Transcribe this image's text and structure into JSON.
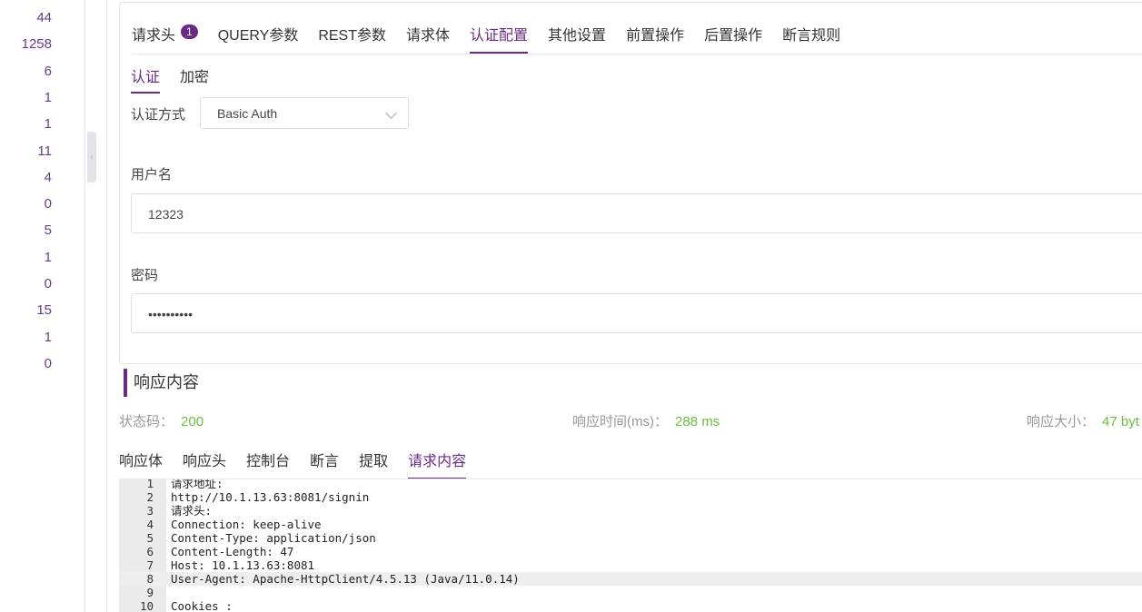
{
  "left_numbers": [
    "44",
    "1258",
    "6",
    "1",
    "1",
    "11",
    "4",
    "0",
    "5",
    "1",
    "0",
    "15",
    "1",
    "0"
  ],
  "config": {
    "tabs": [
      {
        "label": "请求头",
        "badge": "1",
        "active": false
      },
      {
        "label": "QUERY参数",
        "active": false
      },
      {
        "label": "REST参数",
        "active": false
      },
      {
        "label": "请求体",
        "active": false
      },
      {
        "label": "认证配置",
        "active": true
      },
      {
        "label": "其他设置",
        "active": false
      },
      {
        "label": "前置操作",
        "active": false
      },
      {
        "label": "后置操作",
        "active": false
      },
      {
        "label": "断言规则",
        "active": false
      }
    ],
    "subtabs": [
      {
        "label": "认证",
        "active": true
      },
      {
        "label": "加密",
        "active": false
      }
    ],
    "auth_method_label": "认证方式",
    "auth_method_value": "Basic Auth",
    "username_label": "用户名",
    "username_value": "12323",
    "password_label": "密码",
    "password_value": "••••••••••"
  },
  "response": {
    "title": "响应内容",
    "status_label": "状态码：",
    "status_value": "200",
    "time_label": "响应时间(ms)：",
    "time_value": "288 ms",
    "size_label": "响应大小：",
    "size_value": "47 byt",
    "tabs": [
      {
        "label": "响应体",
        "active": false
      },
      {
        "label": "响应头",
        "active": false
      },
      {
        "label": "控制台",
        "active": false
      },
      {
        "label": "断言",
        "active": false
      },
      {
        "label": "提取",
        "active": false
      },
      {
        "label": "请求内容",
        "active": true
      }
    ],
    "code_lines": [
      {
        "n": "1",
        "text": "请求地址:"
      },
      {
        "n": "2",
        "text": "http://10.1.13.63:8081/signin"
      },
      {
        "n": "3",
        "text": "请求头:"
      },
      {
        "n": "4",
        "text": "Connection: keep-alive"
      },
      {
        "n": "5",
        "text": "Content-Type: application/json"
      },
      {
        "n": "6",
        "text": "Content-Length: 47"
      },
      {
        "n": "7",
        "text": "Host: 10.1.13.63:8081"
      },
      {
        "n": "8",
        "text": "User-Agent: Apache-HttpClient/4.5.13 (Java/11.0.14)",
        "highlight": true
      },
      {
        "n": "9",
        "text": ""
      },
      {
        "n": "10",
        "text": "Cookies :"
      }
    ]
  },
  "colors": {
    "accent": "#6b2a86",
    "success": "#67c23a",
    "muted": "#999999"
  }
}
